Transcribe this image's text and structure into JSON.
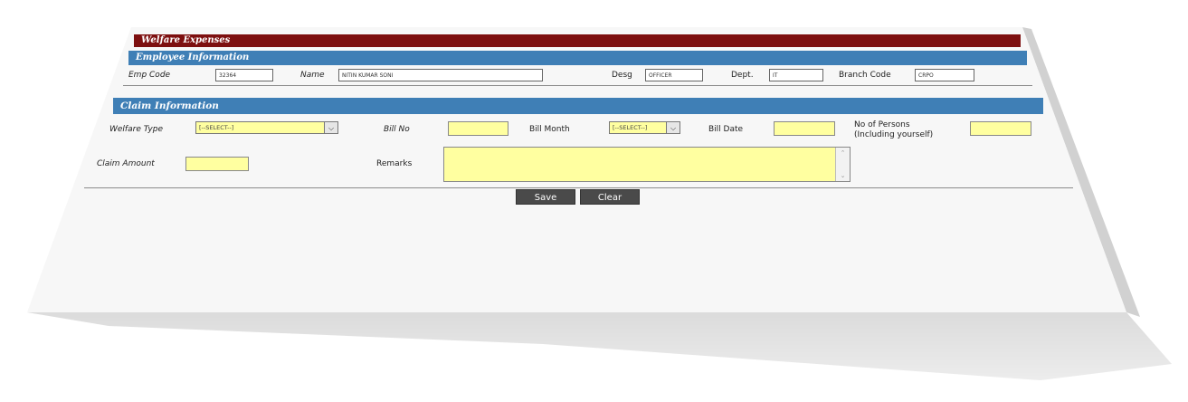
{
  "header": {
    "title": "Welfare Expenses"
  },
  "employee": {
    "section_title": "Employee Information",
    "emp_code_label": "Emp Code",
    "emp_code_value": "32364",
    "name_label": "Name",
    "name_value": "NITIN KUMAR SONI",
    "desg_label": "Desg",
    "desg_value": "OFFICER",
    "dept_label": "Dept.",
    "dept_value": "IT",
    "branch_label": "Branch Code",
    "branch_value": "CRPO"
  },
  "claim": {
    "section_title": "Claim Information",
    "welfare_type_label": "Welfare Type",
    "welfare_type_selected": "[--SELECT--]",
    "bill_no_label": "Bill No",
    "bill_month_label": "Bill Month",
    "bill_month_selected": "[--SELECT--]",
    "bill_date_label": "Bill Date",
    "persons_label_line1": "No of Persons",
    "persons_label_line2": "(Including yourself)",
    "claim_amount_label": "Claim Amount",
    "remarks_label": "Remarks"
  },
  "actions": {
    "save_label": "Save",
    "clear_label": "Clear"
  },
  "colors": {
    "title_bar": "#7d0f0f",
    "section_bar": "#3f7fb6",
    "input_bg": "#ffffa0",
    "button_bg": "#4a4a4a"
  },
  "icons": {
    "dropdown": "chevron-down-icon",
    "scroll_up": "scroll-up-icon",
    "scroll_down": "scroll-down-icon"
  }
}
